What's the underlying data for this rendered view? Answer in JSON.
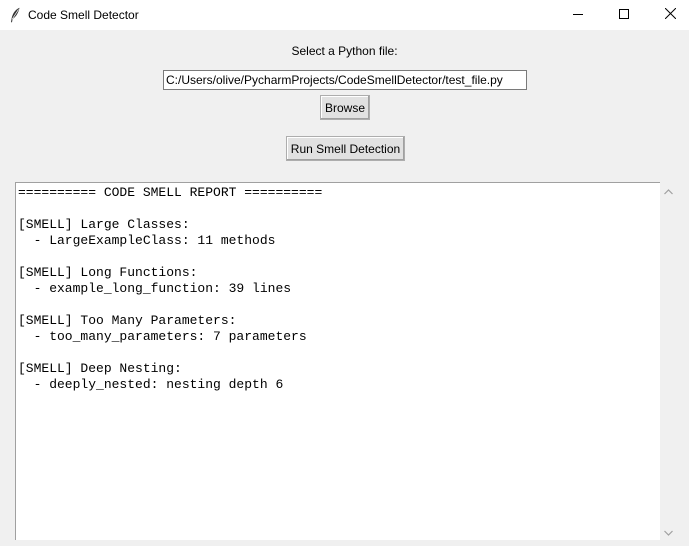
{
  "window": {
    "title": "Code Smell Detector",
    "icon": "feather-icon"
  },
  "controls": {
    "minimize_icon": "minimize-icon",
    "maximize_icon": "maximize-icon",
    "close_icon": "close-icon"
  },
  "file_select": {
    "label": "Select a Python file:",
    "path_value": "C:/Users/olive/PycharmProjects/CodeSmellDetector/test_file.py",
    "browse_label": "Browse"
  },
  "run_button": {
    "label": "Run Smell Detection"
  },
  "report": {
    "lines": [
      "========== CODE SMELL REPORT ==========",
      "",
      "[SMELL] Large Classes:",
      "  - LargeExampleClass: 11 methods",
      "",
      "[SMELL] Long Functions:",
      "  - example_long_function: 39 lines",
      "",
      "[SMELL] Too Many Parameters:",
      "  - too_many_parameters: 7 parameters",
      "",
      "[SMELL] Deep Nesting:",
      "  - deeply_nested: nesting depth 6"
    ]
  },
  "scrollbar": {
    "up_icon": "scroll-up-arrow-icon",
    "down_icon": "scroll-down-arrow-icon"
  },
  "colors": {
    "window_bg": "#f0f0f0",
    "titlebar_bg": "#ffffff",
    "button_bg": "#e1e1e1",
    "button_border": "#adadad",
    "text_area_bg": "#ffffff"
  }
}
